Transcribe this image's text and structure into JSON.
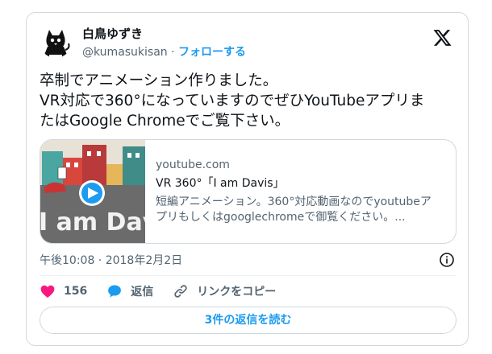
{
  "author": {
    "display_name": "白鳥ゆずき",
    "handle": "@kumasukisan",
    "separator": "·",
    "follow_label": "フォローする"
  },
  "tweet": {
    "text": "卒制でアニメーション作りました。\nVR対応で360°になっていますのでぜひYouTubeアプリま\nたはGoogle Chromeでご覧下さい。"
  },
  "link_card": {
    "domain": "youtube.com",
    "title": "VR 360°「I am Davis」",
    "description": "短編アニメーション。360°対応動画なのでyoutubeア\nプリもしくはgooglechromeで御覧ください。...",
    "thumbnail_text": "I am Dav"
  },
  "timestamp": "午後10:08 · 2018年2月2日",
  "actions": {
    "like_count": "156",
    "reply_label": "返信",
    "copy_link_label": "リンクをコピー"
  },
  "read_replies_label": "3件の返信を読む",
  "icons": {
    "brand": "x-logo-icon",
    "like": "heart-icon",
    "reply": "speech-bubble-icon",
    "copy": "link-icon",
    "info": "info-icon",
    "play": "play-icon"
  },
  "colors": {
    "accent": "#1d9bf0",
    "like": "#f91880",
    "text": "#0f1419",
    "muted": "#536471",
    "border": "#cfd9de"
  }
}
